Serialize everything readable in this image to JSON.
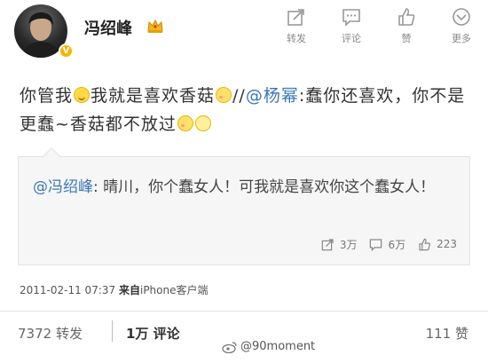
{
  "header": {
    "username": "冯绍峰",
    "verified_badge": "V",
    "actions": [
      {
        "label": "转发",
        "icon": "repost-icon"
      },
      {
        "label": "评论",
        "icon": "comment-icon"
      },
      {
        "label": "赞",
        "icon": "thumbs-up-icon"
      },
      {
        "label": "更多",
        "icon": "more-icon"
      }
    ]
  },
  "post": {
    "text_part1": "你管我",
    "text_part2": "我就是喜欢香菇",
    "text_part3": "//",
    "mention": "@杨幂",
    "text_part4": ":蠢你还喜欢，你不是更蠢~香菇都不放过"
  },
  "repost": {
    "mention": "@冯绍峰",
    "text": ": 晴川，你个蠢女人！可我就是喜欢你这个蠢女人！",
    "reposts": "3万",
    "comments": "6万",
    "likes": "223"
  },
  "meta": {
    "timestamp": "2011-02-11 07:37",
    "source_prefix": "来自",
    "source": "iPhone客户端"
  },
  "stats": {
    "reposts": "7372 转发",
    "comments": "1万 评论",
    "likes": "111 赞"
  },
  "watermark": {
    "text": "@90moment"
  },
  "colors": {
    "link": "#3a76b5",
    "badge": "#f5b400"
  }
}
